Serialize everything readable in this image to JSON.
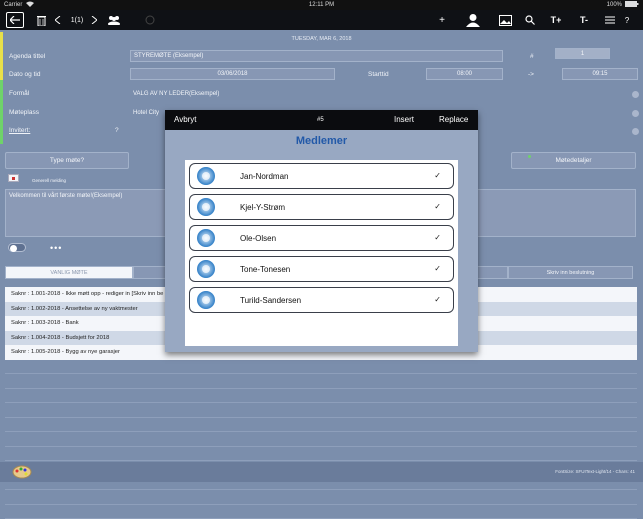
{
  "status_bar": {
    "carrier": "Carrier",
    "time": "12:11 PM",
    "battery": "100%"
  },
  "toolbar": {
    "page_indicator": "1(1)",
    "text_larger": "T+",
    "text_smaller": "T-",
    "help": "?",
    "add": "+"
  },
  "date_header": "TUESDAY, MAR 6, 2018",
  "form": {
    "agenda_label": "Agenda tittel",
    "agenda_value": "STYREMØTE (Eksempel)",
    "number_label": "#",
    "number_value": "1",
    "date_label": "Dato og tid",
    "date_value": "03/06/2018",
    "start_label": "Starttid",
    "start_value": "08:00",
    "arrow": "->",
    "end_value": "09:15",
    "purpose_label": "Formål",
    "purpose_value": "VALG AV NY LEDER(Eksempel)",
    "venue_label": "Møteplass",
    "venue_value": "Hotel City",
    "invited_label": "Invitert:",
    "invited_q": "?"
  },
  "tabs": {
    "type": "Type møte?",
    "details": "Møtedetaljer"
  },
  "general_label": "Generell melding",
  "message_text": "Velkommen til vårt første møte!(Eksempel)",
  "segments": {
    "regular": "VANLIG MØTE",
    "write_decision": "Skriv inn beslutning"
  },
  "list_items": [
    "Saknr : 1.001-2018  - Ikke møtt opp - rediger in  [Skriv inn be",
    "Saknr : 1.002-2018  - Ansettelse av ny vaktmester",
    "Saknr : 1.003-2018  - Bank",
    "Saknr : 1.004-2018  - Budsjett for 2018",
    "Saknr : 1.005-2018  - Bygg av nye garasjer"
  ],
  "footer_font": "FontSize: SFUIText-Light/14 - Chars: 41",
  "modal": {
    "cancel": "Avbryt",
    "count": "#5",
    "insert": "Insert",
    "replace": "Replace",
    "title": "Medlemer",
    "check": "✓",
    "members": [
      "Jan-Nordman",
      "Kjel-Y-Strøm",
      "Ole-Olsen",
      "Tone-Tonesen",
      "Turild-Sandersen"
    ]
  },
  "colors": {
    "accent_yellow": "#e8e04a",
    "accent_green": "#6fd36a",
    "modal_title": "#2259a8"
  }
}
